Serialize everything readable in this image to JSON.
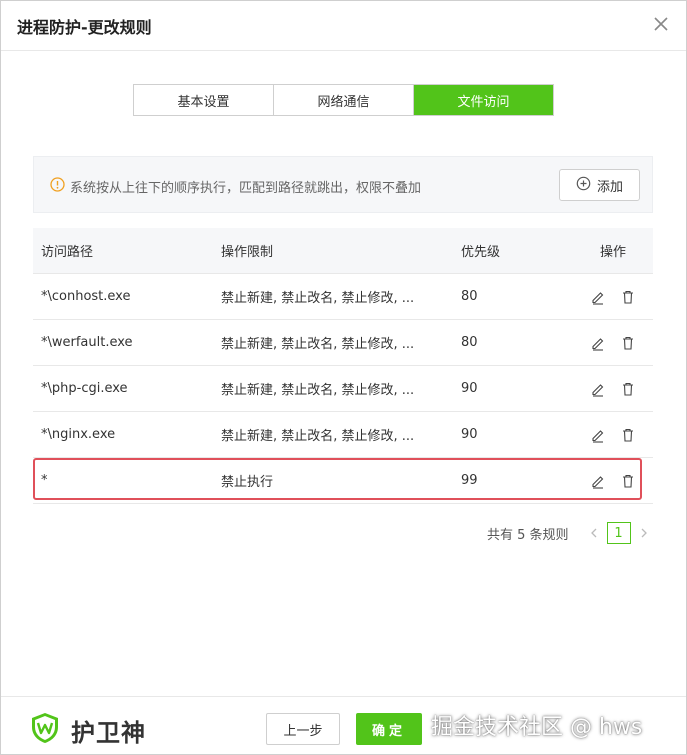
{
  "dialog": {
    "title": "进程防护-更改规则"
  },
  "tabs": [
    {
      "label": "基本设置",
      "active": false
    },
    {
      "label": "网络通信",
      "active": false
    },
    {
      "label": "文件访问",
      "active": true
    }
  ],
  "notice": {
    "text": "系统按从上往下的顺序执行，匹配到路径就跳出，权限不叠加",
    "icon": "info-circle-icon"
  },
  "add_button": {
    "label": "添加",
    "icon": "plus-circle-icon"
  },
  "table": {
    "headers": [
      "访问路径",
      "操作限制",
      "优先级",
      "操作"
    ],
    "rows": [
      {
        "path": "*\\conhost.exe",
        "limits": "禁止新建, 禁止改名, 禁止修改, ...",
        "priority": "80"
      },
      {
        "path": "*\\werfault.exe",
        "limits": "禁止新建, 禁止改名, 禁止修改, ...",
        "priority": "80"
      },
      {
        "path": "*\\php-cgi.exe",
        "limits": "禁止新建, 禁止改名, 禁止修改, ...",
        "priority": "90"
      },
      {
        "path": "*\\nginx.exe",
        "limits": "禁止新建, 禁止改名, 禁止修改, ...",
        "priority": "90"
      },
      {
        "path": "*",
        "limits": "禁止执行",
        "priority": "99"
      }
    ]
  },
  "pagination": {
    "summary": "共有 5 条规则",
    "current_page": "1"
  },
  "footer": {
    "brand": "护卫神",
    "prev_label": "上一步",
    "ok_label": "确定",
    "watermark": "掘金技术社区 @ hws"
  },
  "colors": {
    "accent": "#52c41a",
    "highlight": "#e0505a",
    "warning": "#f0a020"
  }
}
